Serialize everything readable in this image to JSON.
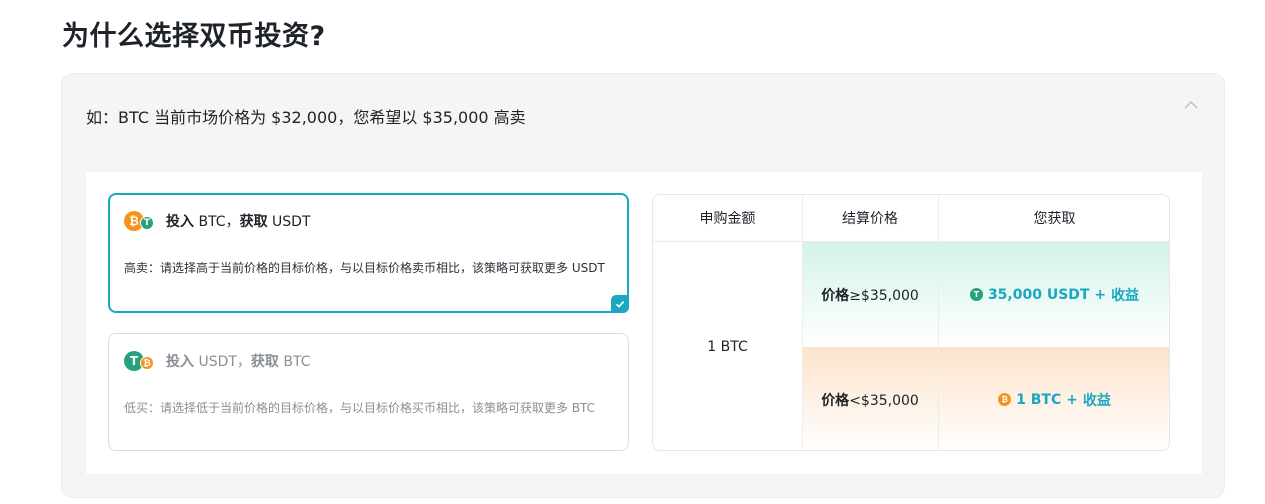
{
  "page": {
    "title": "为什么选择双币投资?"
  },
  "faq": {
    "question": "如：BTC 当前市场价格为 $32,000，您希望以 $35,000 高卖",
    "expanded": true
  },
  "options": [
    {
      "selected": true,
      "invest_label": "投入",
      "invest_coin": "BTC，",
      "get_label": "获取",
      "get_coin": "USDT",
      "description": "高卖：请选择高于当前价格的目标价格，与以目标价格卖币相比，该策略可获取更多 USDT"
    },
    {
      "selected": false,
      "invest_label": "投入",
      "invest_coin": "USDT，",
      "get_label": "获取",
      "get_coin": "BTC",
      "description": "低买：请选择低于当前价格的目标价格，与以目标价格买币相比，该策略可获取更多 BTC"
    }
  ],
  "table": {
    "headers": [
      "申购金额",
      "结算价格",
      "您获取"
    ],
    "amount": "1 BTC",
    "rows": [
      {
        "price_label": "价格",
        "price_value": "≥$35,000",
        "gain_amount": "35,000 USDT +",
        "gain_label": "收益",
        "coin": "usdt"
      },
      {
        "price_label": "价格",
        "price_value": "<$35,000",
        "gain_amount": "1 BTC +",
        "gain_label": "收益",
        "coin": "btc"
      }
    ]
  },
  "colors": {
    "accent": "#1aa7c2",
    "btc": "#f7931a",
    "usdt": "#26a17b"
  },
  "icons": {
    "btc": "₿",
    "usdt": "T"
  }
}
